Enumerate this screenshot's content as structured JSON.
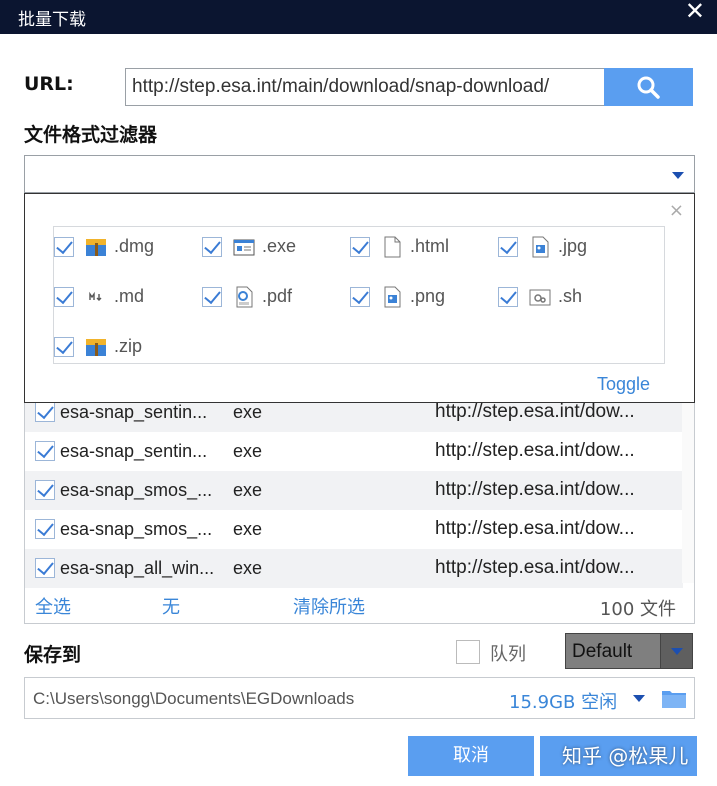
{
  "window": {
    "title": "批量下载",
    "close_glyph": "✕"
  },
  "url": {
    "label": "URL:",
    "value": "http://step.esa.int/main/download/snap-download/",
    "search_icon": "search-icon"
  },
  "filter": {
    "label": "文件格式过滤器",
    "value": "",
    "popup_close_glyph": "×",
    "toggle_label": "Toggle",
    "types": [
      {
        "ext": ".dmg",
        "checked": true,
        "icon": "archive-icon"
      },
      {
        "ext": ".exe",
        "checked": true,
        "icon": "window-app-icon"
      },
      {
        "ext": ".html",
        "checked": true,
        "icon": "blank-file-icon"
      },
      {
        "ext": ".jpg",
        "checked": true,
        "icon": "image-file-icon"
      },
      {
        "ext": ".md",
        "checked": true,
        "icon": "markdown-file-icon"
      },
      {
        "ext": ".pdf",
        "checked": true,
        "icon": "pdf-file-icon"
      },
      {
        "ext": ".png",
        "checked": true,
        "icon": "image-file-icon"
      },
      {
        "ext": ".sh",
        "checked": true,
        "icon": "script-file-icon"
      },
      {
        "ext": ".zip",
        "checked": true,
        "icon": "archive-icon"
      }
    ]
  },
  "files": {
    "rows": [
      {
        "name": "esa-snap_sentin...",
        "type": "exe",
        "url": "http://step.esa.int/dow...",
        "checked": true
      },
      {
        "name": "esa-snap_sentin...",
        "type": "exe",
        "url": "http://step.esa.int/dow...",
        "checked": true
      },
      {
        "name": "esa-snap_smos_...",
        "type": "exe",
        "url": "http://step.esa.int/dow...",
        "checked": true
      },
      {
        "name": "esa-snap_smos_...",
        "type": "exe",
        "url": "http://step.esa.int/dow...",
        "checked": true
      },
      {
        "name": "esa-snap_all_win...",
        "type": "exe",
        "url": "http://step.esa.int/dow...",
        "checked": true
      }
    ],
    "select_all": "全选",
    "select_none": "无",
    "clear_selected": "清除所选",
    "count": "100 文件"
  },
  "save": {
    "label": "保存到",
    "queue_label": "队列",
    "queue_checked": false,
    "category": "Default",
    "path": "C:\\Users\\songg\\Documents\\EGDownloads",
    "free_space": "15.9GB 空闲"
  },
  "buttons": {
    "cancel": "取消",
    "ok": ""
  },
  "watermark": "知乎 @松果儿",
  "colors": {
    "accent": "#5a9ef0",
    "link": "#3a86d8",
    "titlebar": "#0b1530"
  }
}
